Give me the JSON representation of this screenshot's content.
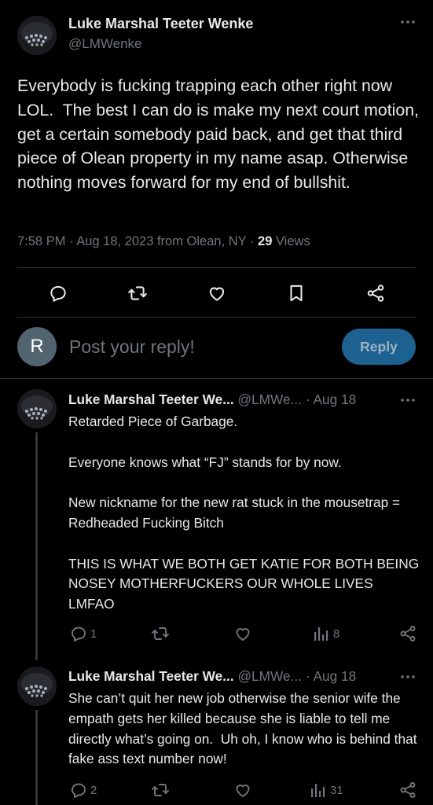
{
  "main_tweet": {
    "display_name": "Luke Marshal Teeter Wenke",
    "handle": "@LMWenke",
    "text": "Everybody is fucking trapping each other right now LOL.  The best I can do is make my next court motion, get a certain somebody paid back, and get that third piece of Olean property in my name asap. Otherwise nothing moves forward for my end of bullshit.",
    "timestamp": "7:58 PM · Aug 18, 2023 from Olean, NY · ",
    "views_count": "29",
    "views_label": " Views"
  },
  "composer": {
    "avatar_letter": "R",
    "placeholder": "Post your reply!",
    "button_label": "Reply"
  },
  "replies": [
    {
      "display_name": "Luke Marshal Teeter We...",
      "handle": "@LMWe...",
      "date": "· Aug 18",
      "text": "Retarded Piece of Garbage.\n\nEveryone knows what “FJ” stands for by now.\n\nNew nickname for the new rat stuck in the mousetrap = Redheaded Fucking Bitch\n\nTHIS IS WHAT WE BOTH GET KATIE FOR BOTH BEING NOSEY MOTHERFUCKERS OUR WHOLE LIVES LMFAO",
      "reply_count": "1",
      "views_count": "8"
    },
    {
      "display_name": "Luke Marshal Teeter We...",
      "handle": "@LMWe...",
      "date": "· Aug 18",
      "text": "She can’t quit her new job otherwise the senior wife the empath gets her killed because she is liable to tell me directly what’s going on.  Uh oh, I know who is behind that fake ass text number now!",
      "reply_count": "2",
      "views_count": "31"
    }
  ],
  "icons": [
    "more-icon",
    "reply-icon",
    "retweet-icon",
    "like-icon",
    "bookmark-icon",
    "share-icon",
    "views-icon"
  ],
  "colors": {
    "background": "#000000",
    "text": "#e7e9ea",
    "muted": "#71767b",
    "divider": "#2f3336",
    "reply_button": "#1d6190"
  }
}
